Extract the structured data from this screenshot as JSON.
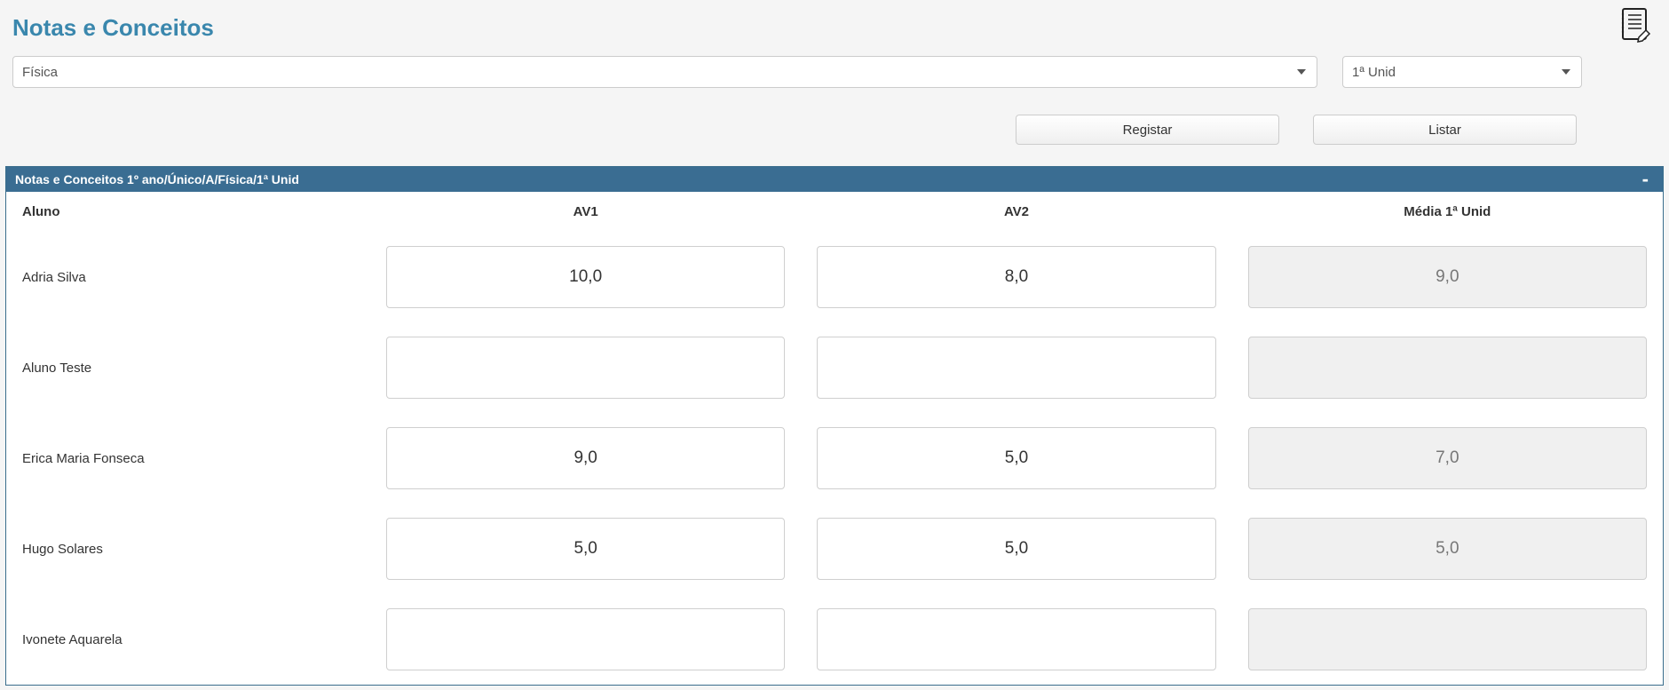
{
  "header": {
    "title": "Notas e Conceitos"
  },
  "filters": {
    "subject_selected": "Física",
    "unit_selected": "1ª Unid"
  },
  "actions": {
    "register_label": "Registar",
    "list_label": "Listar"
  },
  "panel": {
    "title": "Notas e Conceitos 1º ano/Único/A/Física/1ª Unid",
    "collapse_symbol": "‐"
  },
  "table": {
    "columns": {
      "aluno": "Aluno",
      "av1": "AV1",
      "av2": "AV2",
      "media": "Média 1ª Unid"
    },
    "rows": [
      {
        "name": "Adria Silva",
        "av1": "10,0",
        "av2": "8,0",
        "media": "9,0"
      },
      {
        "name": "Aluno Teste",
        "av1": "",
        "av2": "",
        "media": ""
      },
      {
        "name": "Erica Maria Fonseca",
        "av1": "9,0",
        "av2": "5,0",
        "media": "7,0"
      },
      {
        "name": "Hugo Solares",
        "av1": "5,0",
        "av2": "5,0",
        "media": "5,0"
      },
      {
        "name": "Ivonete Aquarela",
        "av1": "",
        "av2": "",
        "media": ""
      }
    ]
  }
}
